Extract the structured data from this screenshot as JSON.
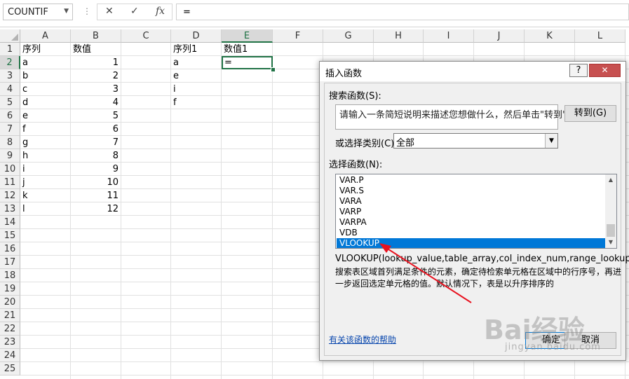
{
  "formula_bar": {
    "name_box": "COUNTIF",
    "cancel_icon": "✕",
    "enter_icon": "✓",
    "fx_icon": "fx",
    "content": "="
  },
  "columns": [
    "A",
    "B",
    "C",
    "D",
    "E",
    "F",
    "G",
    "H",
    "I",
    "J",
    "K",
    "L"
  ],
  "selected_column": "E",
  "rows": [
    "1",
    "2",
    "3",
    "4",
    "5",
    "6",
    "7",
    "8",
    "9",
    "10",
    "11",
    "12",
    "13",
    "14",
    "15",
    "16",
    "17",
    "18",
    "19",
    "20",
    "21",
    "22",
    "23",
    "24",
    "25"
  ],
  "selected_row": "2",
  "cells": {
    "A1": "序列",
    "B1": "数值",
    "D1": "序列1",
    "E1": "数值1",
    "A2": "a",
    "B2": "1",
    "D2": "a",
    "A3": "b",
    "B3": "2",
    "D3": "e",
    "A4": "c",
    "B4": "3",
    "D4": "i",
    "A5": "d",
    "B5": "4",
    "D5": "f",
    "A6": "e",
    "B6": "5",
    "A7": "f",
    "B7": "6",
    "A8": "g",
    "B8": "7",
    "A9": "h",
    "B9": "8",
    "A10": "i",
    "B10": "9",
    "A11": "j",
    "B11": "10",
    "A12": "k",
    "B12": "11",
    "A13": "l",
    "B13": "12"
  },
  "active_cell_value": "=",
  "dialog": {
    "title": "插入函数",
    "help_button": "?",
    "close_button": "✕",
    "search_label": "搜索函数(S):",
    "search_text": "请输入一条简短说明来描述您想做什么，然后单击\"转到\"",
    "goto_button": "转到(G)",
    "category_label": "或选择类别(C):",
    "category_value": "全部",
    "function_list_label": "选择函数(N):",
    "functions": [
      "VAR.P",
      "VAR.S",
      "VARA",
      "VARP",
      "VARPA",
      "VDB",
      "VLOOKUP"
    ],
    "selected_function": "VLOOKUP",
    "syntax": "VLOOKUP(lookup_value,table_array,col_index_num,range_lookup)",
    "description": "搜索表区域首列满足条件的元素，确定待检索单元格在区域中的行序号，再进一步返回选定单元格的值。默认情况下，表是以升序排序的",
    "help_link": "有关该函数的帮助",
    "ok_button": "确定",
    "cancel_button": "取消"
  },
  "annotation_color": "#e8121f",
  "accent_color": "#217346",
  "watermark": "Bai经验",
  "watermark_url": "jingyan.baidu.com"
}
